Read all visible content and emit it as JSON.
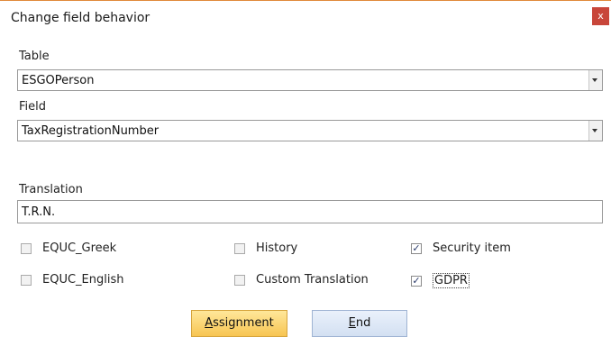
{
  "window": {
    "title": "Change field behavior",
    "close_glyph": "x"
  },
  "table": {
    "label": "Table",
    "value": "ESGOPerson"
  },
  "field": {
    "label": "Field",
    "value": "TaxRegistrationNumber"
  },
  "translation": {
    "label": "Translation",
    "value": "T.R.N."
  },
  "checkboxes": [
    {
      "label": "EQUC_Greek",
      "checked": false
    },
    {
      "label": "EQUC_English",
      "checked": false
    },
    {
      "label": "History",
      "checked": false
    },
    {
      "label": "Custom Translation",
      "checked": false
    },
    {
      "label": "Security item",
      "checked": true
    },
    {
      "label": "GDPR",
      "checked": true
    }
  ],
  "buttons": {
    "assignment_mnemonic": "A",
    "assignment_rest": "ssignment",
    "end_mnemonic": "E",
    "end_rest": "nd"
  },
  "colors": {
    "accent": "#e08a3a",
    "close": "#c8463a",
    "primary_button": "#f7c552",
    "secondary_button": "#d3e0f2"
  }
}
